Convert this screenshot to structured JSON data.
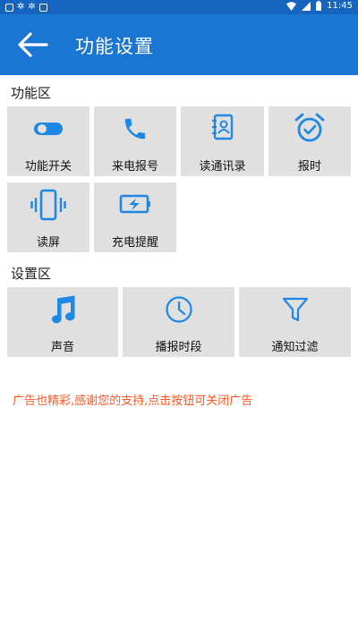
{
  "status": {
    "time": "11:45"
  },
  "header": {
    "title": "功能设置"
  },
  "sections": {
    "functions": "功能区",
    "settings": "设置区"
  },
  "functions": [
    {
      "label": "功能开关",
      "icon": "toggle-icon"
    },
    {
      "label": "来电报号",
      "icon": "phone-icon"
    },
    {
      "label": "读通讯录",
      "icon": "contacts-icon"
    },
    {
      "label": "报时",
      "icon": "alarm-clock-icon"
    },
    {
      "label": "读屏",
      "icon": "vibrating-phone-icon"
    },
    {
      "label": "充电提醒",
      "icon": "battery-charging-icon"
    }
  ],
  "settings": [
    {
      "label": "声音",
      "icon": "music-note-icon"
    },
    {
      "label": "播报时段",
      "icon": "clock-icon"
    },
    {
      "label": "通知过滤",
      "icon": "filter-icon"
    }
  ],
  "notice": "广告也精彩,感谢您的支持,点击按钮可关闭广告",
  "colors": {
    "appbar": "#1976d2",
    "statusbar": "#1565c0",
    "icon": "#1e88e5",
    "tile": "#e0e0e0",
    "notice": "#ff5722"
  }
}
